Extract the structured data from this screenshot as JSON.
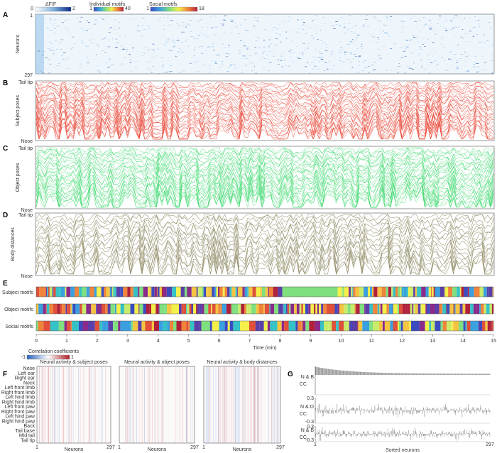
{
  "panels": {
    "A": {
      "letter": "A",
      "ylabel": "Neurons",
      "top_tick": "1",
      "bottom_tick": "297"
    },
    "B": {
      "letter": "B",
      "ylabel": "Subject poses",
      "top_tick": "Tail tip",
      "bottom_tick": "Nose"
    },
    "C": {
      "letter": "C",
      "ylabel": "Object poses",
      "top_tick": "Tail tip",
      "bottom_tick": "Nose"
    },
    "D": {
      "letter": "D",
      "ylabel": "Body distances",
      "top_tick": "Tail tip",
      "bottom_tick": "Nose"
    },
    "E": {
      "letter": "E",
      "rows": [
        "Subject motifs",
        "Object motifs",
        "Social motifs"
      ],
      "xlabel": "Time (min)",
      "xticks": [
        "0",
        "1",
        "2",
        "3",
        "4",
        "5",
        "6",
        "7",
        "8",
        "9",
        "10",
        "11",
        "12",
        "13",
        "14",
        "15"
      ]
    },
    "F": {
      "letter": "F",
      "colorbar_title": "Correlation coefficients",
      "cb_min": "-1",
      "cb_max": "1",
      "subtitles": [
        "Neural activity & subject poses",
        "Neural activity & object poses",
        "Neural activity & body distances"
      ],
      "row_labels": [
        "Nose",
        "Left ear",
        "Right ear",
        "Neck",
        "Left front limb",
        "Right front limb",
        "Left hind limb",
        "Right hind limb",
        "Left front paw",
        "Right front paw",
        "Left hind paw",
        "Right hind paw",
        "Back",
        "Tail base",
        "Mid tail",
        "Tail tip"
      ],
      "xlabel": "Neurons",
      "x_start": "1",
      "x_end": "297"
    },
    "G": {
      "letter": "G",
      "rows": [
        [
          "N & B",
          "CC"
        ],
        [
          "N & O",
          "CC"
        ],
        [
          "N & B",
          "CC"
        ]
      ],
      "ytick_top": "0.3",
      "ytick_mid": "0",
      "ytick_bot": "-0.3",
      "xlabel": "Sorted neurons",
      "x_start": "1",
      "x_end": "297"
    }
  },
  "colorbars": {
    "dff": {
      "title": "ΔF/F",
      "min": "0",
      "max": "2"
    },
    "individual": {
      "title": "Individual motifs",
      "min": "1",
      "max": "40"
    },
    "social": {
      "title": "Social motifs",
      "min": "1",
      "max": "18"
    }
  },
  "colors": {
    "subject": "#e8402f",
    "object": "#39d86b",
    "distance": "#8f8a64",
    "neural": "#3b7fc4"
  }
}
